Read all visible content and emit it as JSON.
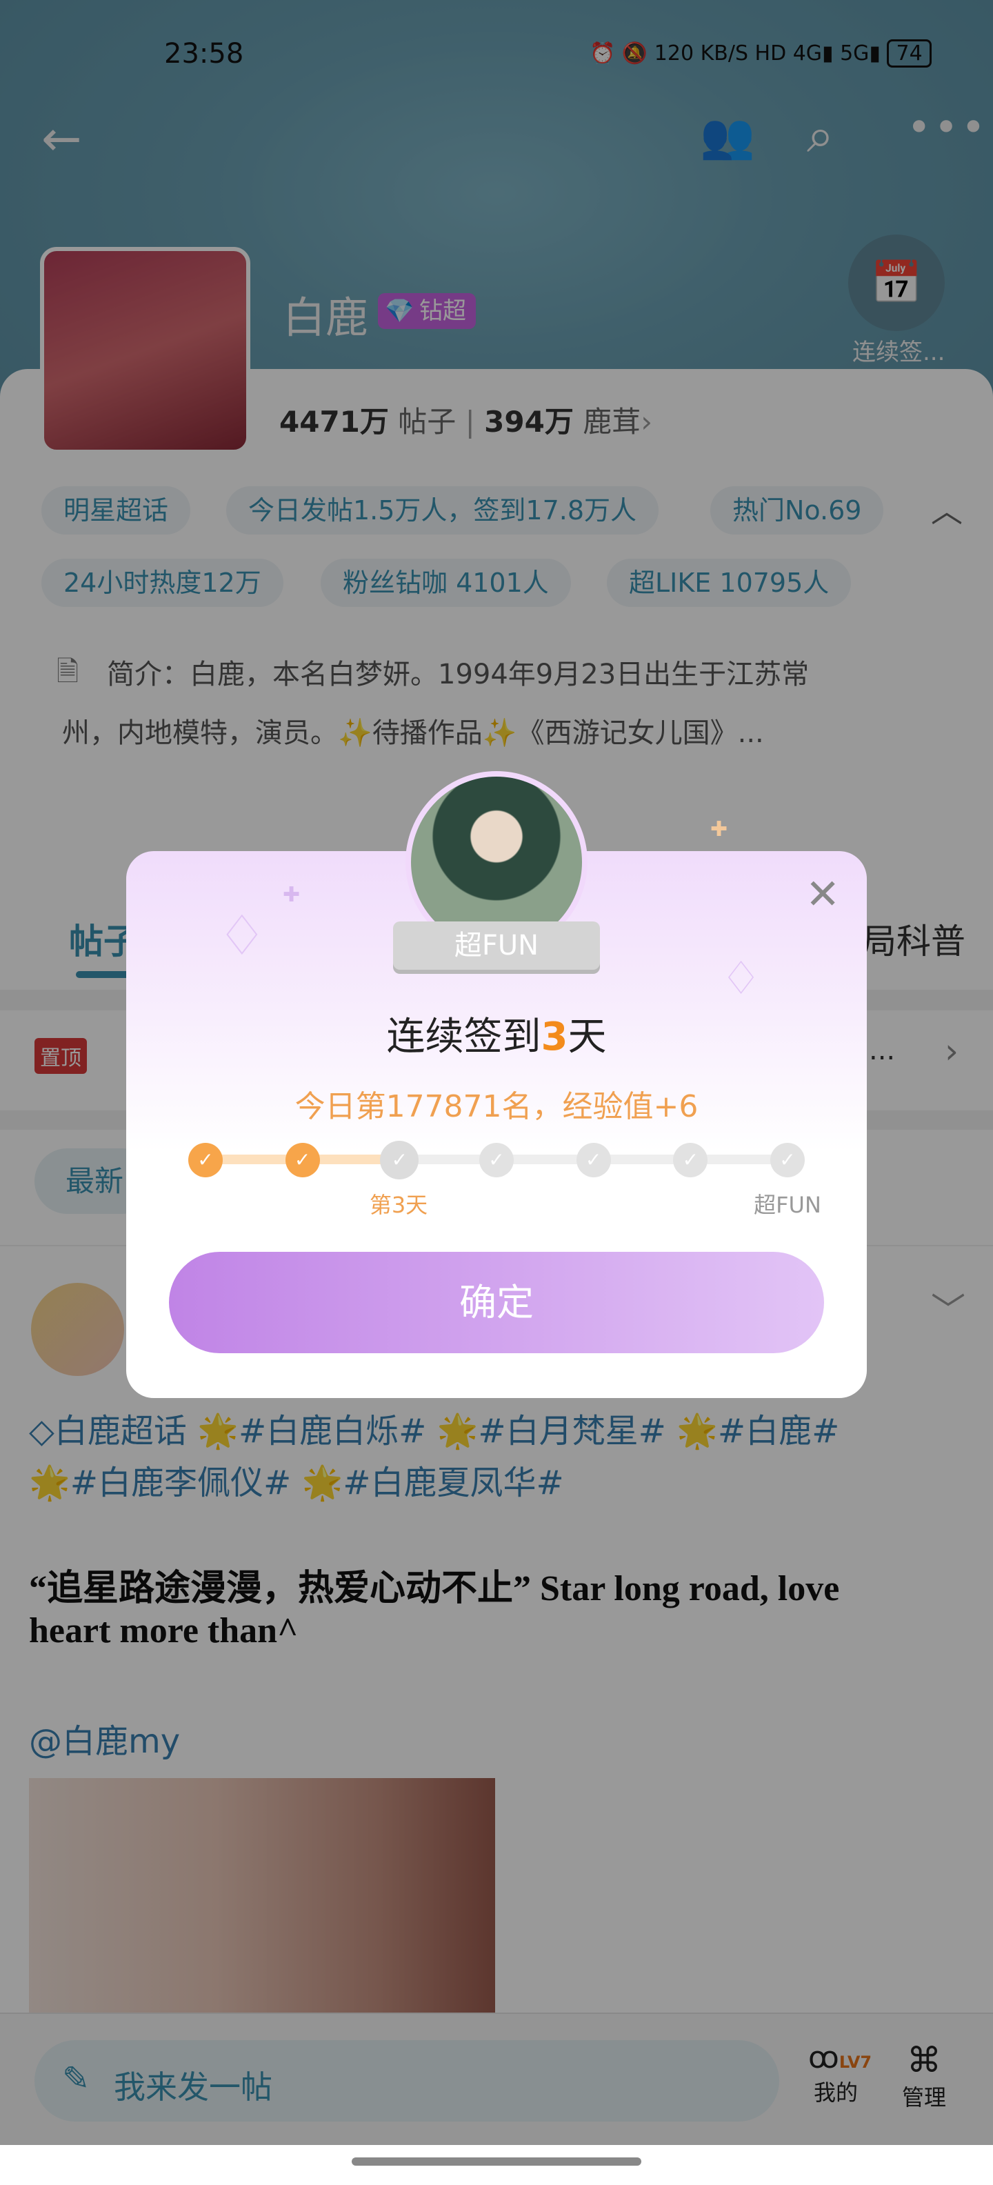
{
  "status_bar": {
    "time": "23:58",
    "speed": "120 KB/S",
    "battery": "74"
  },
  "header": {
    "name": "白鹿",
    "badge": "钻超",
    "sign_in_label": "连续签...",
    "stats": {
      "posts_value": "4471万",
      "posts_label": "帖子",
      "fans_value": "394万",
      "fans_label": "鹿茸"
    }
  },
  "tags": [
    "明星超话",
    "今日发帖1.5万人，签到17.8万人",
    "热门No.69",
    "24小时热度12万",
    "粉丝钻咖 4101人",
    "超LIKE 10795人"
  ],
  "intro": {
    "line1": "简介：白鹿，本名白梦妍。1994年9月23日出生于江苏常",
    "line2": "州，内地模特，演员。✨待播作品✨《西游记女儿国》..."
  },
  "tabs": {
    "first": "帖子",
    "last": "局科普"
  },
  "pinned": {
    "badge": "置顶",
    "ellipsis": "..."
  },
  "filter": {
    "label": "最新"
  },
  "post": {
    "hashtags1": "◇白鹿超话 🌟#白鹿白烁# 🌟#白月梵星# 🌟#白鹿#",
    "hashtags2": "🌟#白鹿李佩仪# 🌟#白鹿夏凤华#",
    "quote1": "“追星路途漫漫，热爱心动不止” Star long road, love",
    "quote2": "heart more than^",
    "mention": "@白鹿my"
  },
  "bottom_bar": {
    "compose_placeholder": "我来发一帖",
    "mine_label": "我的",
    "level": "LV7",
    "manage_label": "管理"
  },
  "modal": {
    "ribbon": "超FUN",
    "title_prefix": "连续签到",
    "title_days": "3",
    "title_suffix": "天",
    "subtitle": "今日第177871名，经验值+6",
    "progress": {
      "days_completed": 3,
      "total": 7
    },
    "day_label": "第3天",
    "end_label": "超FUN",
    "confirm": "确定",
    "accent": "#f7a54a",
    "button_gradient": [
      "#c084e6",
      "#e2c4f6"
    ]
  }
}
